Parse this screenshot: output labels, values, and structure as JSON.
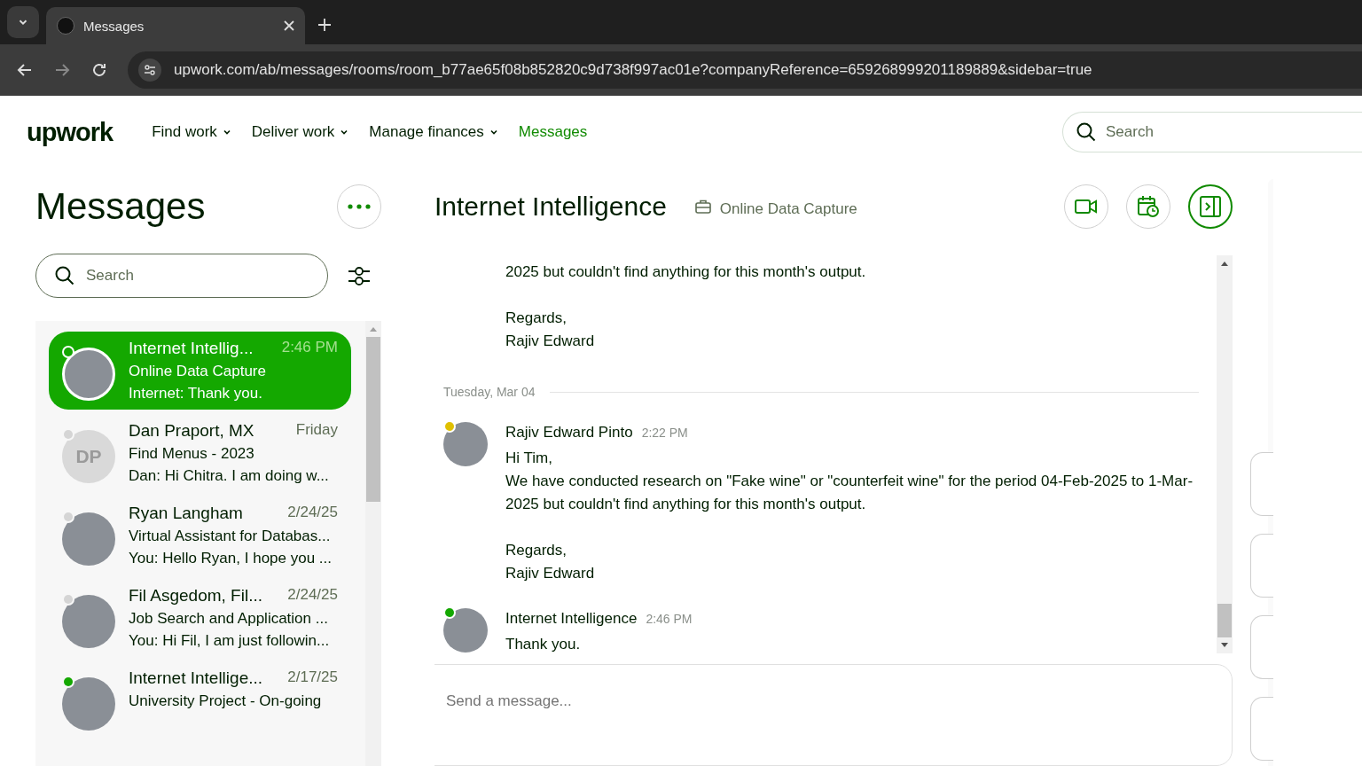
{
  "browser": {
    "tab_title": "Messages",
    "url": "upwork.com/ab/messages/rooms/room_b77ae65f08b852820c9d738f997ac01e?companyReference=659268999201189889&sidebar=true"
  },
  "nav": {
    "logo": "upwork",
    "items": [
      {
        "label": "Find work",
        "dropdown": true,
        "selected": false
      },
      {
        "label": "Deliver work",
        "dropdown": true,
        "selected": false
      },
      {
        "label": "Manage finances",
        "dropdown": true,
        "selected": false
      },
      {
        "label": "Messages",
        "dropdown": false,
        "selected": true
      }
    ],
    "search": {
      "placeholder": "Search"
    }
  },
  "sidebar": {
    "title": "Messages",
    "search": {
      "placeholder": "Search"
    },
    "conversations": [
      {
        "name": "Internet Intellig...",
        "time": "2:46 PM",
        "subject": "Online Data Capture",
        "preview": "Internet: Thank you.",
        "selected": true,
        "color": "#14a800",
        "avatar": {
          "kind": "photo"
        }
      },
      {
        "name": "Dan Praport, MX",
        "time": "Friday",
        "subject": "Find Menus - 2023",
        "preview": "Dan: Hi Chitra. I am doing w...",
        "selected": false,
        "color": "#d5d5d5",
        "avatar": {
          "kind": "initials",
          "text": "DP"
        }
      },
      {
        "name": "Ryan Langham",
        "time": "2/24/25",
        "subject": "Virtual Assistant for Databas...",
        "preview": "You: Hello Ryan, I hope you ...",
        "selected": false,
        "color": "#d5d5d5",
        "avatar": {
          "kind": "photo"
        }
      },
      {
        "name": "Fil Asgedom, Fil...",
        "time": "2/24/25",
        "subject": "Job Search and Application ...",
        "preview": "You: Hi Fil, I am just followin...",
        "selected": false,
        "color": "#d5d5d5",
        "avatar": {
          "kind": "photo"
        }
      },
      {
        "name": "Internet Intellige...",
        "time": "2/17/25",
        "subject": "University Project - On-going",
        "selected": false,
        "color": "#14a800",
        "avatar": {
          "kind": "photo"
        }
      }
    ]
  },
  "chat": {
    "title": "Internet Intelligence",
    "job": "Online Data Capture",
    "items": [
      {
        "kind": "continuation",
        "paragraphs": [
          "2025 but couldn't find anything for this month's output.",
          "Regards,\nRajiv Edward"
        ]
      },
      {
        "kind": "date",
        "label": "Tuesday, Mar 04"
      },
      {
        "kind": "message",
        "sender": "Rajiv Edward Pinto",
        "time": "2:22 PM",
        "color": "#e0c000",
        "paragraphs": [
          "Hi Tim,\nWe have conducted research on \"Fake wine\" or \"counterfeit wine\" for the period 04-Feb-2025 to 1-Mar-2025 but couldn't find anything for this month's output.",
          "Regards,\nRajiv Edward"
        ]
      },
      {
        "kind": "message",
        "sender": "Internet Intelligence",
        "time": "2:46 PM",
        "color": "#14a800",
        "paragraphs": [
          "Thank you."
        ]
      }
    ],
    "composer": {
      "placeholder": "Send a message..."
    }
  }
}
